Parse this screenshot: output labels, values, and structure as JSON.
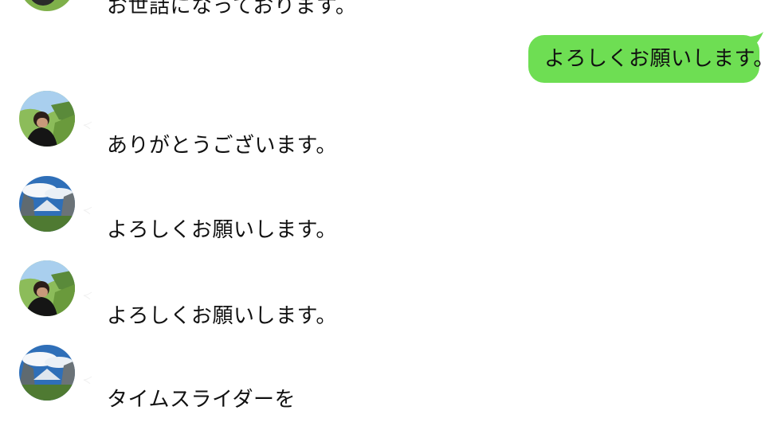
{
  "messages": [
    {
      "direction": "in",
      "sender": "",
      "avatar": "avatar-person-icon",
      "text": "お世話になっております。"
    },
    {
      "direction": "out",
      "text": "よろしくお願いします。"
    },
    {
      "direction": "in",
      "sender": "",
      "avatar": "avatar-person-icon",
      "text": "ありがとうございます。"
    },
    {
      "direction": "in",
      "sender": "",
      "avatar": "avatar-landscape-icon",
      "text": "よろしくお願いします。"
    },
    {
      "direction": "in",
      "sender": "",
      "avatar": "avatar-person-icon",
      "text": "よろしくお願いします。"
    },
    {
      "direction": "in",
      "sender": "",
      "avatar": "avatar-landscape-icon",
      "text": "タイムスライダーを"
    }
  ],
  "colors": {
    "background": "#ffffff",
    "outgoing_bubble": "#6ede53",
    "text": "#111111"
  }
}
